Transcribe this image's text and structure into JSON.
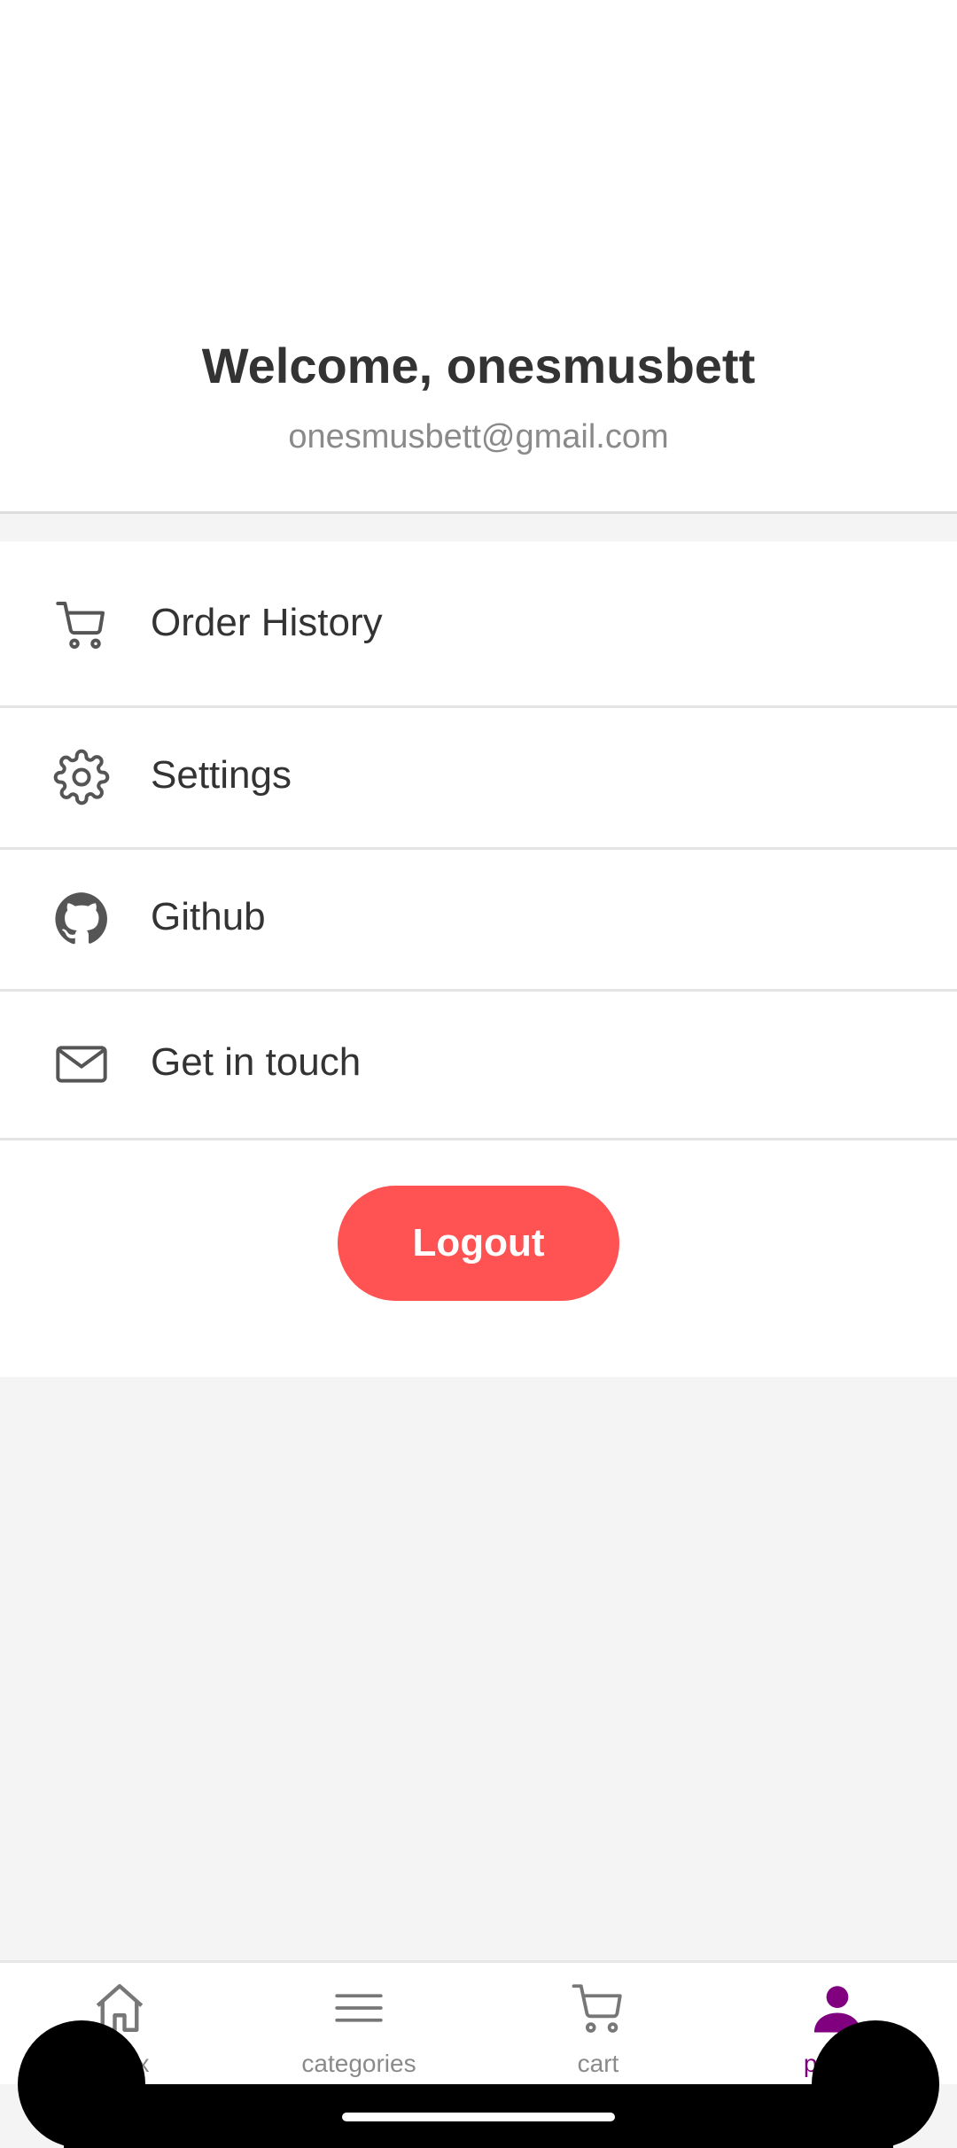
{
  "profile": {
    "welcome": "Welcome, onesmusbett",
    "email": "onesmusbett@gmail.com"
  },
  "menu": {
    "items": [
      {
        "label": "Order History",
        "icon": "cart-icon"
      },
      {
        "label": "Settings",
        "icon": "gear-icon"
      },
      {
        "label": "Github",
        "icon": "github-icon"
      },
      {
        "label": "Get in touch",
        "icon": "mail-icon"
      }
    ],
    "logout_label": "Logout"
  },
  "tabbar": {
    "tabs": [
      {
        "label": "index",
        "icon": "home-icon"
      },
      {
        "label": "categories",
        "icon": "menu-icon"
      },
      {
        "label": "cart",
        "icon": "cart-icon"
      },
      {
        "label": "profile",
        "icon": "person-icon"
      }
    ],
    "active": "profile"
  },
  "colors": {
    "accent": "#800080",
    "logout": "#fe5253",
    "text": "#333333",
    "muted": "#8a8a8a",
    "background": "#f4f4f4"
  }
}
